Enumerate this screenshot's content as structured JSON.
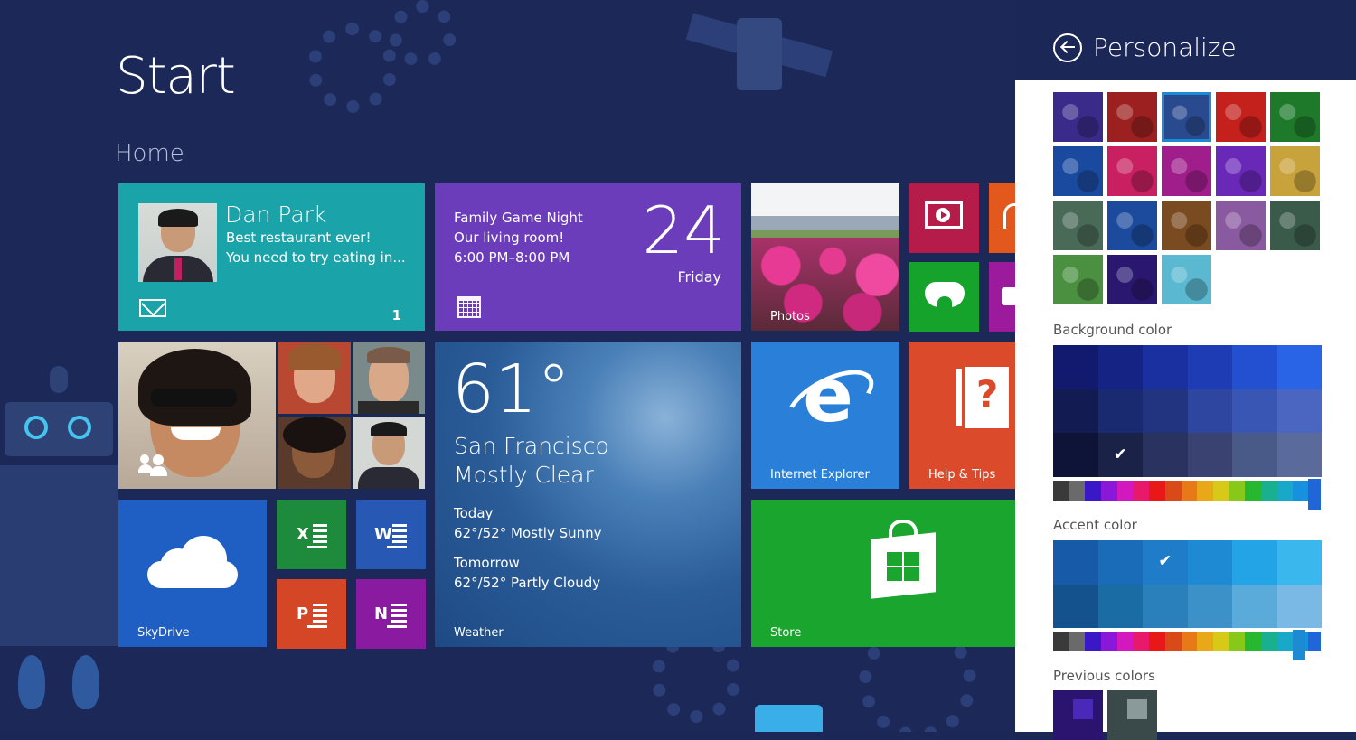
{
  "start": {
    "title": "Start",
    "group": "Home"
  },
  "tiles": {
    "people": {
      "name": "Dan Park",
      "line1": "Best restaurant ever!",
      "line2": "You need to try eating in...",
      "count": "1"
    },
    "calendar": {
      "line1": "Family Game Night",
      "line2": "Our living room!",
      "line3": "6:00 PM–8:00 PM",
      "day_num": "24",
      "day_name": "Friday"
    },
    "photos": {
      "label": "Photos"
    },
    "weather": {
      "temp": "61°",
      "city": "San Francisco",
      "cond": "Mostly Clear",
      "today_label": "Today",
      "today": "62°/52° Mostly Sunny",
      "tomorrow_label": "Tomorrow",
      "tomorrow": "62°/52° Partly Cloudy",
      "label": "Weather"
    },
    "ie": {
      "label": "Internet Explorer",
      "glyph": "e"
    },
    "help": {
      "label": "Help & Tips",
      "glyph": "?"
    },
    "skydrive": {
      "label": "SkyDrive"
    },
    "excel": {
      "glyph": "X"
    },
    "word": {
      "glyph": "W"
    },
    "ppt": {
      "glyph": "P"
    },
    "onenote": {
      "glyph": "N"
    },
    "store": {
      "label": "Store"
    }
  },
  "icons": {
    "mail": "mail-icon",
    "calendar": "calendar-icon",
    "video": "video-icon",
    "games": "xbox-controller-icon",
    "people": "people-icon",
    "cloud": "cloud-icon",
    "store": "store-bag-icon",
    "back": "back-arrow-icon"
  },
  "panel": {
    "title": "Personalize",
    "background_label": "Background color",
    "accent_label": "Accent color",
    "previous_label": "Previous colors",
    "patterns": [
      "#3a2a8a",
      "#9c2020",
      "#2a4a8f",
      "#c4201c",
      "#1e7a2a",
      "#1a4aa0",
      "#c82060",
      "#a01e8c",
      "#6a28b8",
      "#c8a23a",
      "#4a6a58",
      "#1c4a9c",
      "#7a4a20",
      "#8a5aa0",
      "#3a5a4a",
      "#4a9040",
      "#2a1870",
      "#5ab8d0"
    ],
    "selected_pattern_index": 2,
    "background_colors": [
      [
        "#121a70",
        "#142384",
        "#1a2fa0",
        "#1e3cb4",
        "#2250d0",
        "#2a64e6"
      ],
      [
        "#121c52",
        "#1a2a70",
        "#223480",
        "#2e46a0",
        "#3a56b4",
        "#4a66c0"
      ],
      [
        "#0e1438",
        "#1a2248",
        "#2a3260",
        "#3a4272",
        "#4a5a88",
        "#5a6a9a"
      ]
    ],
    "background_checked": "2-1",
    "accent_colors": [
      [
        "#175aa8",
        "#1a6cb8",
        "#1e7cc8",
        "#1e8ad4",
        "#22a4e6",
        "#3ab8ee"
      ],
      [
        "#14528e",
        "#1a6ca4",
        "#2a80ba",
        "#3c92c8",
        "#5aaada",
        "#7ab8e6"
      ]
    ],
    "accent_checked": "0-2",
    "hue_colors": [
      "#3a3a3a",
      "#6a6a6a",
      "#3a18c8",
      "#8a18d8",
      "#d418c0",
      "#e8186a",
      "#e81818",
      "#d84a18",
      "#e87818",
      "#e8a818",
      "#d8c818",
      "#88c818",
      "#28b830",
      "#18b090",
      "#18a8c8",
      "#1890e0"
    ],
    "previous_colors": [
      {
        "outer": "#2a1470",
        "inner": "#4a28b8"
      },
      {
        "outer": "#3a4a4a",
        "inner": "#8a9a9a"
      }
    ]
  }
}
